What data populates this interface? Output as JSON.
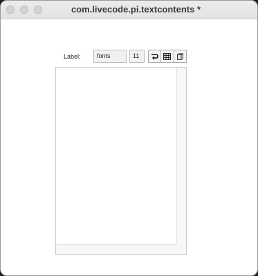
{
  "window": {
    "title": "com.livecode.pi.textcontents *"
  },
  "toolbar": {
    "label_caption": "Label:",
    "label_value": "fonts",
    "font_size_value": "11",
    "buttons": [
      {
        "name": "wrap-icon"
      },
      {
        "name": "table-icon"
      },
      {
        "name": "book-icon"
      }
    ]
  },
  "editor": {
    "content": ""
  }
}
